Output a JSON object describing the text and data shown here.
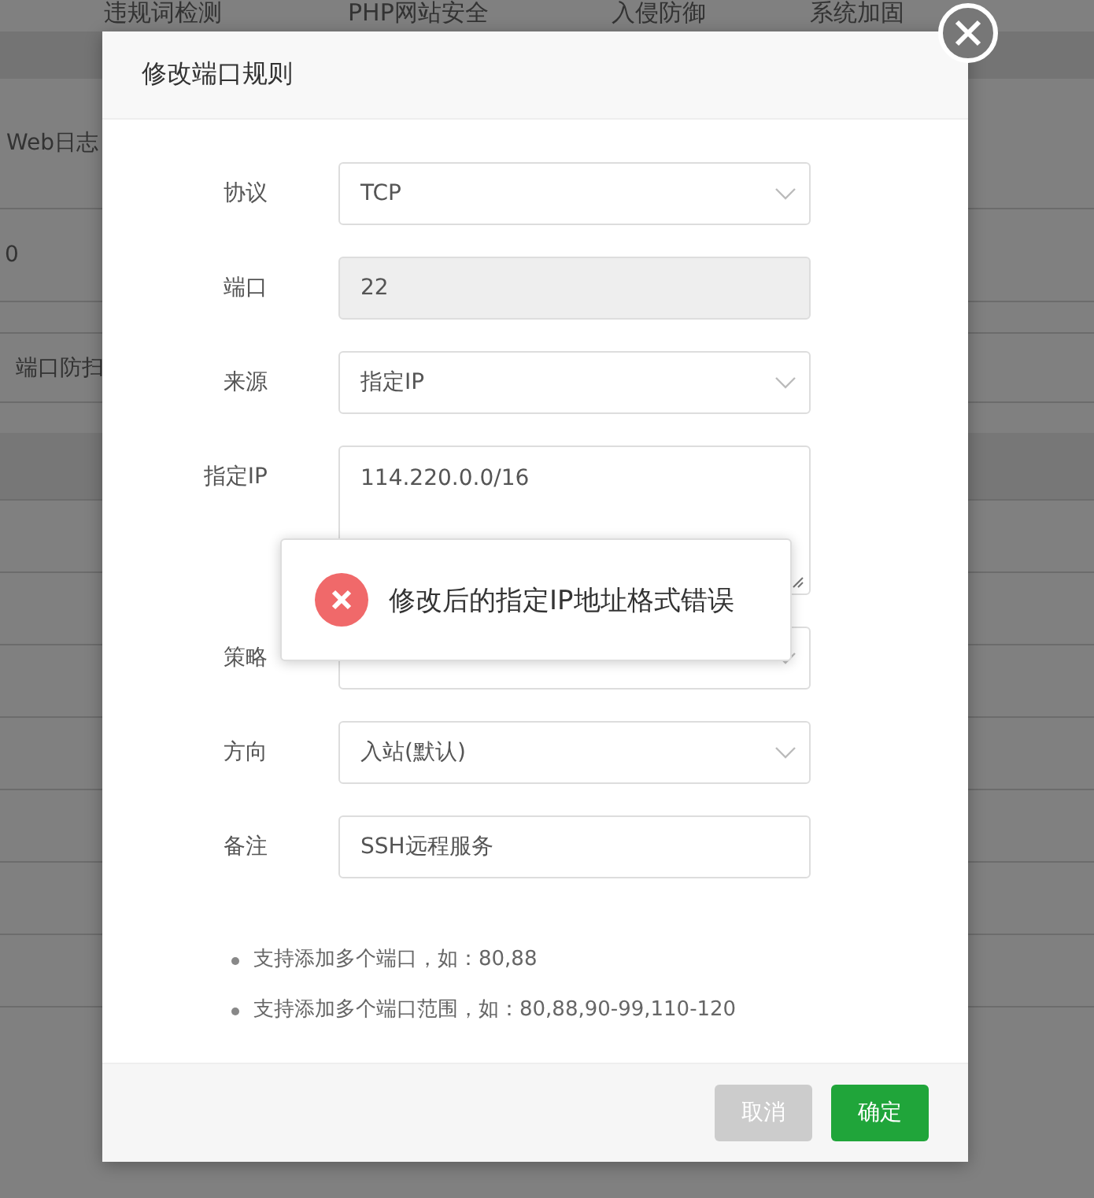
{
  "background": {
    "nav_tabs": [
      "违规词检测",
      "PHP网站安全",
      "入侵防御",
      "系统加固"
    ],
    "section_tab": "Web日志",
    "stat_value": "0",
    "sub_tab": "端口防扫"
  },
  "dialog": {
    "title": "修改端口规则",
    "fields": [
      {
        "label": "协议",
        "kind": "select",
        "value": "TCP",
        "disabled": false
      },
      {
        "label": "端口",
        "kind": "input",
        "value": "22",
        "disabled": true
      },
      {
        "label": "来源",
        "kind": "select",
        "value": "指定IP",
        "disabled": false
      },
      {
        "label": "指定IP",
        "kind": "textarea",
        "value": "114.220.0.0/16",
        "disabled": false
      },
      {
        "label": "策略",
        "kind": "select",
        "disabled": false
      },
      {
        "label": "方向",
        "kind": "select",
        "value": "入站(默认)",
        "disabled": false
      },
      {
        "label": "备注",
        "kind": "input",
        "value": "SSH远程服务",
        "disabled": false
      }
    ],
    "notes": [
      "支持添加多个端口，如：80,88",
      "支持添加多个端口范围，如：80,88,90-99,110-120"
    ],
    "buttons": [
      {
        "label": "取消",
        "kind": "secondary"
      },
      {
        "label": "确定",
        "kind": "primary"
      }
    ]
  },
  "toast": {
    "kind": "error",
    "message": "修改后的指定IP地址格式错误"
  }
}
